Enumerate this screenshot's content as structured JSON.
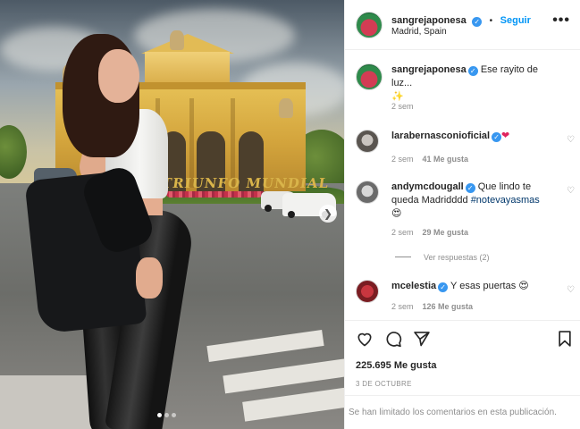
{
  "post": {
    "username": "sangrejaponesa",
    "follow_label": "Seguir",
    "location": "Madrid, Spain",
    "more_label": "•••",
    "image_lettering": "TRIUNFO MUNDIAL",
    "carousel_count": 3
  },
  "caption": {
    "username": "sangrejaponesa",
    "text": "Ese rayito de luz...",
    "emoji": "✨",
    "time": "2 sem"
  },
  "comments": [
    {
      "username": "larabernasconioficial",
      "text": "",
      "emoji": "❤",
      "time": "2 sem",
      "likes": "41 Me gusta"
    },
    {
      "username": "andymcdougall",
      "text": "Que lindo te queda Madridddd",
      "hashtag": "#notevayasmas",
      "emoji": "😍",
      "time": "2 sem",
      "likes": "29 Me gusta"
    },
    {
      "username": "mcelestia",
      "text": "Y esas puertas",
      "emoji": "😍",
      "time": "2 sem",
      "likes": "126 Me gusta"
    }
  ],
  "replies_label": "Ver respuestas (2)",
  "footer": {
    "likes": "225.695 Me gusta",
    "date": "3 DE OCTUBRE",
    "comments_limited": "Se han limitado los comentarios en esta publicación."
  },
  "icons": {
    "like": "heart-icon",
    "comment": "comment-icon",
    "share": "paper-plane-icon",
    "save": "bookmark-icon",
    "next": "chevron-right-icon"
  },
  "colors": {
    "accent": "#0095f6",
    "verified": "#3897f0",
    "muted": "#8e8e8e",
    "text": "#262626"
  }
}
